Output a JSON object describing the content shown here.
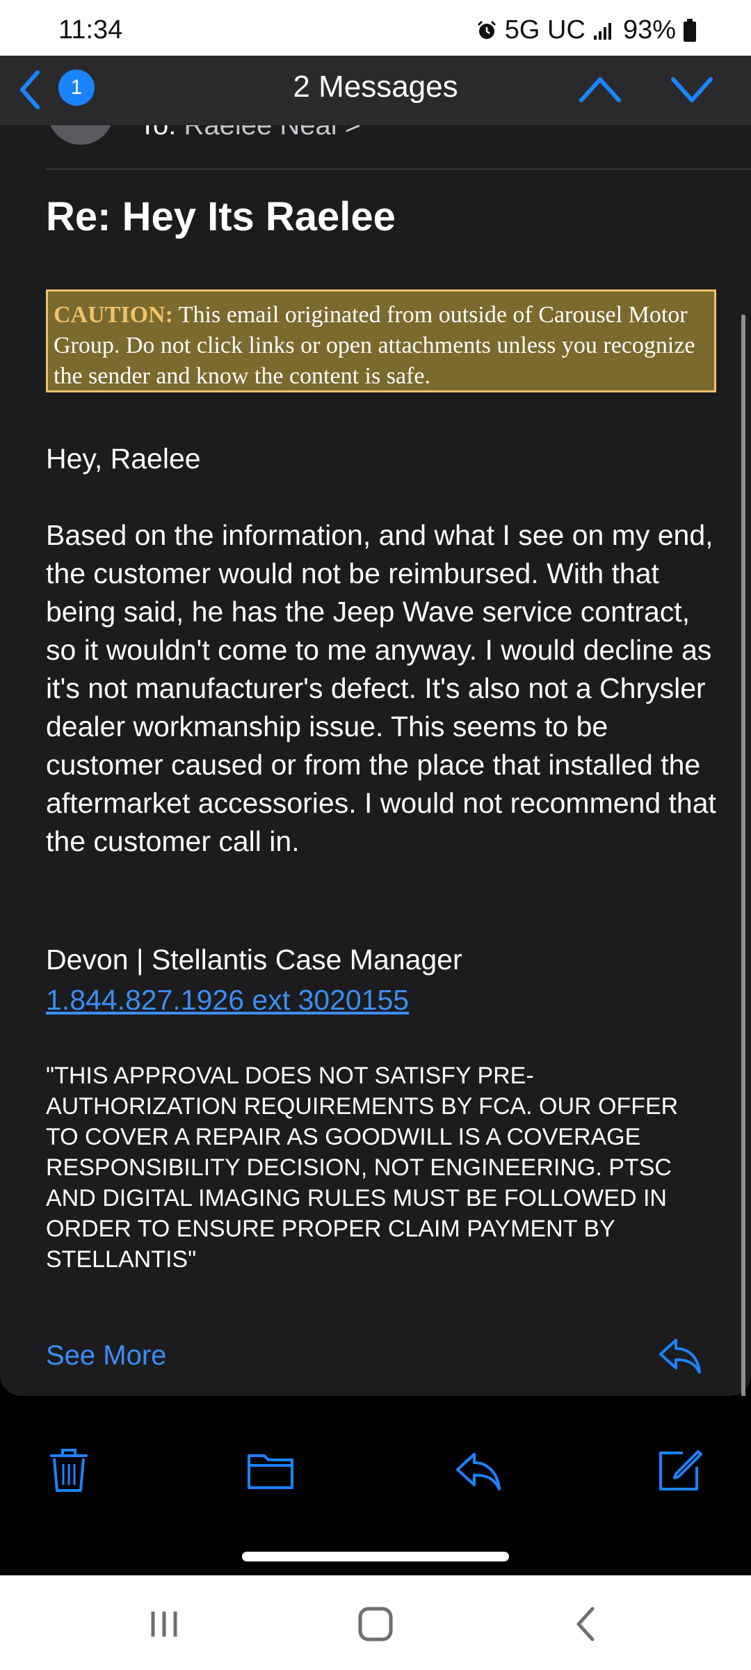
{
  "status_bar": {
    "time": "11:34",
    "network": "5G UC",
    "battery": "93%",
    "icons": [
      "alarm-icon",
      "signal-icon",
      "battery-icon"
    ]
  },
  "nav": {
    "unread_count": "1",
    "title": "2 Messages",
    "accent_color": "#1a84ff"
  },
  "email": {
    "recipient_label": "To:",
    "recipient_name": "Raelee Neal >",
    "subject": "Re: Hey Its Raelee",
    "caution_label": "CAUTION:",
    "caution_text": " This email originated from outside of Carousel Motor Group. Do not click links or open attachments unless you recognize the sender and know the content is safe.",
    "greeting": "Hey, Raelee",
    "body": "Based on the information, and what I see on my end, the customer would not be reimbursed. With that being said, he has the Jeep Wave service contract, so it wouldn't come to me anyway.  I would decline as it's not manufacturer's defect.  It's also not a Chrysler dealer workmanship issue.  This seems to be customer caused or from the place that installed the aftermarket accessories.  I would not recommend that the customer call in.",
    "signature": "Devon | Stellantis Case Manager",
    "phone": "1.844.827.1926 ext 3020155",
    "disclaimer": "\"THIS APPROVAL DOES NOT SATISFY PRE-AUTHORIZATION REQUIREMENTS BY FCA. OUR OFFER TO COVER A REPAIR AS GOODWILL IS A COVERAGE RESPONSIBILITY DECISION, NOT ENGINEERING. PTSC AND DIGITAL IMAGING RULES MUST BE FOLLOWED IN ORDER TO ENSURE PROPER CLAIM PAYMENT BY STELLANTIS\"",
    "see_more": "See More"
  },
  "toolbar": {
    "icons": [
      "trash-icon",
      "folder-icon",
      "reply-icon",
      "compose-icon"
    ]
  },
  "android_nav": {
    "icons": [
      "recents-icon",
      "home-icon",
      "back-icon"
    ]
  },
  "colors": {
    "link": "#3b8ef7",
    "caution_bg": "#7b6a2e",
    "caution_border": "#f0c36a",
    "card_bg": "#1c1c1e"
  }
}
